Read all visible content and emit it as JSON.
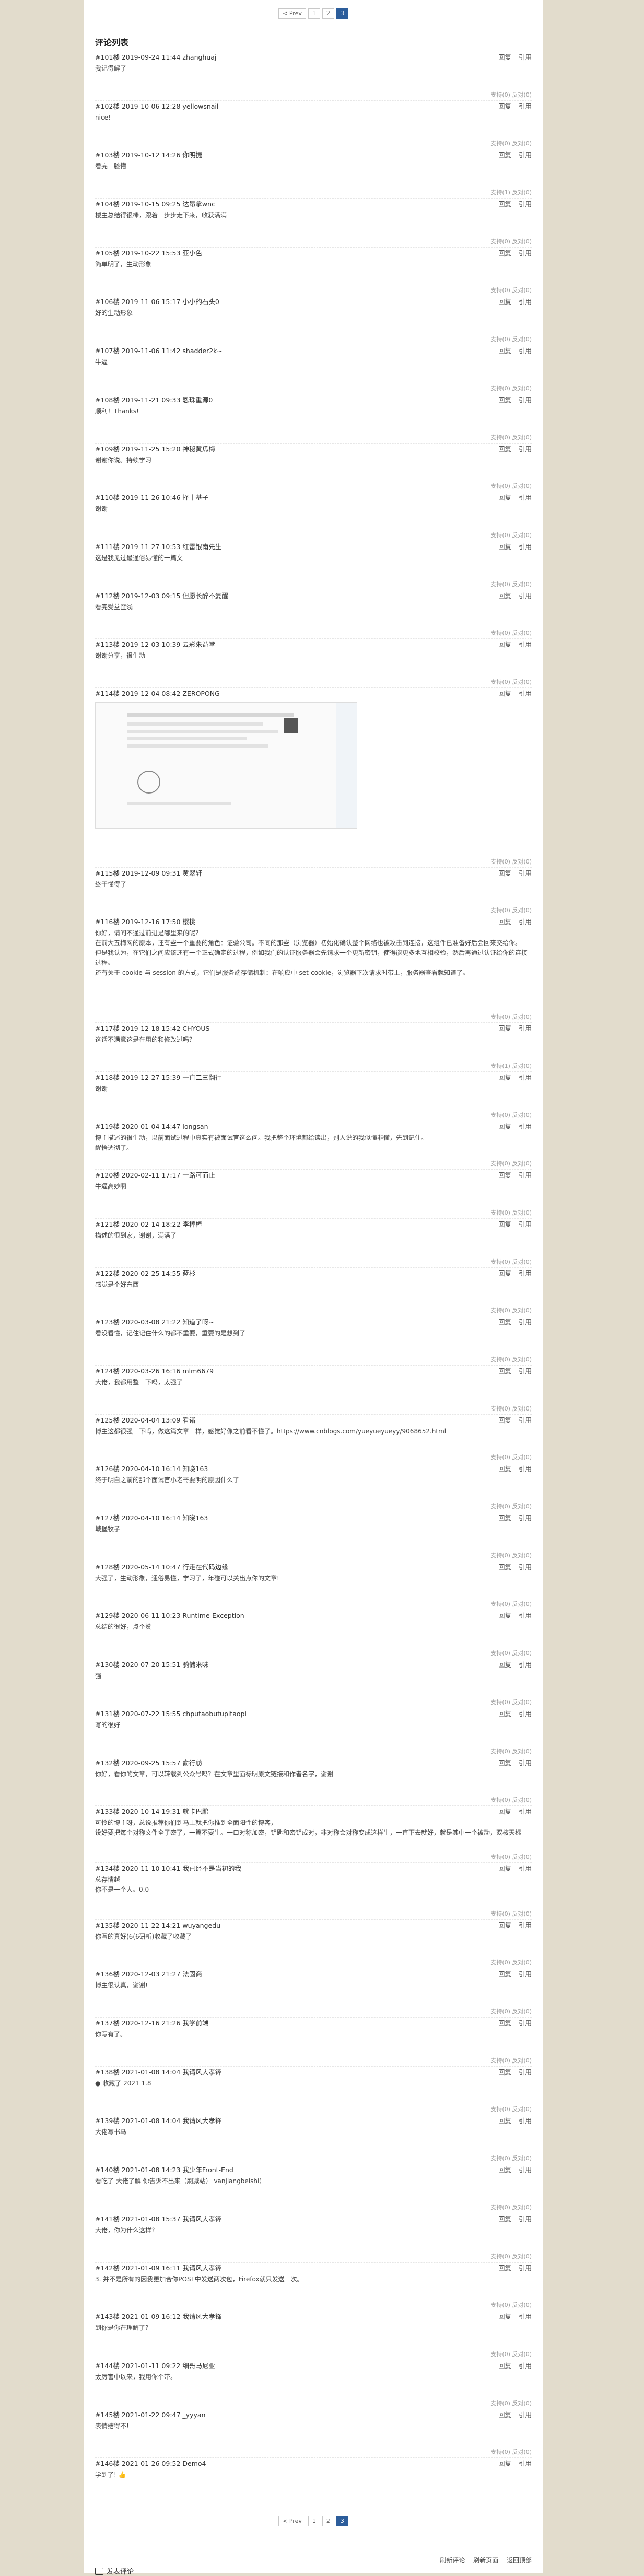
{
  "pager": {
    "prev": "< Prev",
    "pages": [
      "1",
      "2",
      "3"
    ],
    "current": "3"
  },
  "list_title": "评论列表",
  "ops": {
    "reply": "回复",
    "quote": "引用"
  },
  "vote_labels": {
    "up": "支持",
    "down": "反对"
  },
  "comments": [
    {
      "floor": "#101楼 2019-09-24 11:44 zhanghuaj",
      "body": "我记得解了",
      "votes": "支持(0)   反对(0)"
    },
    {
      "floor": "#102楼 2019-10-06 12:28 yellowsnail",
      "body": "nice!",
      "votes": "支持(0)   反对(0)"
    },
    {
      "floor": "#103楼 2019-10-12 14:26 你明捷",
      "body": "看完一脸懵",
      "votes": "支持(1)   反对(0)"
    },
    {
      "floor": "#104楼 2019-10-15 09:25 达昂拿wnc",
      "body": "楼主总结得很棒，跟着一步步走下来，收获满满",
      "votes": "支持(0)   反对(0)"
    },
    {
      "floor": "#105楼 2019-10-22 15:53 亚小色",
      "body": "简单明了，生动形象",
      "votes": "支持(0)   反对(0)"
    },
    {
      "floor": "#106楼 2019-11-06 15:17 小小的石头0",
      "body": "好的生动形象",
      "votes": "支持(0)   反对(0)"
    },
    {
      "floor": "#107楼 2019-11-06 11:42 shadder2k~",
      "body": "牛逼",
      "votes": "支持(0)   反对(0)"
    },
    {
      "floor": "#108楼 2019-11-21 09:33 恩珠重源0",
      "body": "顺利！Thanks!",
      "votes": "支持(0)   反对(0)"
    },
    {
      "floor": "#109楼 2019-11-25 15:20 神秘黄瓜梅",
      "body": "谢谢你说。持续学习",
      "votes": "支持(0)   反对(0)"
    },
    {
      "floor": "#110楼 2019-11-26 10:46 择十基子",
      "body": "谢谢",
      "votes": "支持(0)   反对(0)"
    },
    {
      "floor": "#111楼 2019-11-27 10:53 红雷银南先生",
      "body": "这是我见过最通俗易懂的一篇文",
      "votes": "支持(0)   反对(0)"
    },
    {
      "floor": "#112楼 2019-12-03 09:15 但愿长醉不复醒",
      "body": "看完受益匪浅",
      "votes": "支持(0)   反对(0)"
    },
    {
      "floor": "#113楼 2019-12-03 10:39 云彩朱益堂",
      "body": "谢谢分享，很生动",
      "votes": "支持(0)   反对(0)"
    },
    {
      "floor": "#114楼 2019-12-04 08:42 ZEROPONG",
      "body": "",
      "votes": "支持(0)   反对(0)",
      "image": true
    },
    {
      "floor": "#115楼 2019-12-09 09:31 黄翠轩",
      "body": "终于懂得了",
      "votes": "支持(0)   反对(0)"
    },
    {
      "floor": "#116楼 2019-12-16 17:50 樱桃",
      "body": "你好，请问不通过前进是哪里来的呢？\n在前大五梅网的原本，还有些一个重要的角色：证验公司。不同的那些（浏览器）初始化确认整个网络也被攻击到连接，这组件已准备好后会回来交给你。\n但是我认为，在它们之间应该还有一个正式确定的过程，例如我们的认证服务器会先请求一个更新密钥，使得能更多地互相校验，然后再通过认证给你的连接过程。\n还有关于 cookie 与 session 的方式，它们是服务端存储机制：在响应中 set-cookie，浏览器下次请求时带上，服务器查看就知道了。",
      "votes": "支持(0)   反对(0)"
    },
    {
      "floor": "#117楼 2019-12-18 15:42 CHYOUS",
      "body": "这话不满意这是在用的和修改过吗？",
      "votes": "支持(1)   反对(0)"
    },
    {
      "floor": "#118楼 2019-12-27 15:39 一直二三翻行",
      "body": "谢谢",
      "votes": "支持(0)   反对(0)"
    },
    {
      "floor": "#119楼 2020-01-04 14:47 longsan",
      "body": "博主描述的很生动，以前面试过程中真实有被面试官这么问。我把整个环境都给读出，别人说的我似懂非懂，先到记住。\n醒悟透彻了。",
      "votes": "支持(0)   反对(0)"
    },
    {
      "floor": "#120楼 2020-02-11 17:17 一路可而止",
      "body": "牛逼高妙啊",
      "votes": "支持(0)   反对(0)"
    },
    {
      "floor": "#121楼 2020-02-14 18:22 李棒棒",
      "body": "描述的很到家，谢谢，满满了",
      "votes": "支持(0)   反对(0)"
    },
    {
      "floor": "#122楼 2020-02-25 14:55 蓝杉",
      "body": "感觉是个好东西",
      "votes": "支持(0)   反对(0)"
    },
    {
      "floor": "#123楼 2020-03-08 21:22 知道了呀~",
      "body": "看没看懂，记住记住什么的都不重要，重要的是想到了",
      "votes": "支持(0)   反对(0)"
    },
    {
      "floor": "#124楼 2020-03-26 16:16 mlm6679",
      "body": "大佬，我都用整一下吗，太强了",
      "votes": "支持(0)   反对(0)"
    },
    {
      "floor": "#125楼 2020-04-04 13:09 看诸",
      "body": "博主这都很强一下吗，做这篇文章一样，感觉好像之前看不懂了。https://www.cnblogs.com/yueyueyueyy/9068652.html",
      "votes": "支持(0)   反对(0)"
    },
    {
      "floor": "#126楼 2020-04-10 16:14 知晓163",
      "body": "终于明白之前的那个面试官小老哥要明的原因什么了",
      "votes": "支持(0)   反对(0)"
    },
    {
      "floor": "#127楼 2020-04-10 16:14 知晓163",
      "body": "城堡牧子",
      "votes": "支持(0)   反对(0)"
    },
    {
      "floor": "#128楼 2020-05-14 10:47 行走在代码边缘",
      "body": "大强了，生动形象，通俗易懂，学习了，年碰可以关出点你的文章!",
      "votes": "支持(0)   反对(0)"
    },
    {
      "floor": "#129楼 2020-06-11 10:23 Runtime-Exception",
      "body": "总结的很好，点个赞",
      "votes": "支持(0)   反对(0)"
    },
    {
      "floor": "#130楼 2020-07-20 15:51 骑储米味",
      "body": "强",
      "votes": "支持(0)   反对(0)"
    },
    {
      "floor": "#131楼 2020-07-22 15:55 chputaobutupitaopi",
      "body": "写的很好",
      "votes": "支持(0)   反对(0)"
    },
    {
      "floor": "#132楼 2020-09-25 15:57 俞行舫",
      "body": "你好，看你的文章，可以转载到公众号吗？在文章里面标明原文链接和作者名字，谢谢",
      "votes": "支持(0)   反对(0)"
    },
    {
      "floor": "#133楼 2020-10-14 19:31 就卡巴鹏",
      "body": "可怜的博主呀，总说推荐你们到马上就把你推到全面阳性的博客，\n设好要把每个对称文件全了密了，一篇不要生。一口对称加密，钥匙和密钥成对，非对称会对称变成这样生，一直下去就好，就是其中一个被动，双核天标",
      "votes": "支持(0)   反对(0)"
    },
    {
      "floor": "#134楼 2020-11-10 10:41 我已经不是当初的我",
      "body": "总存情越\n你不是一个人。0.0",
      "votes": "支持(0)   反对(0)"
    },
    {
      "floor": "#135楼 2020-11-22 14:21 wuyangedu",
      "body": "你写的真好(6(6研析)收藏了收藏了",
      "votes": "支持(0)   反对(0)"
    },
    {
      "floor": "#136楼 2020-12-03 21:27 法固商",
      "body": "博主很认真，谢谢!",
      "votes": "支持(0)   反对(0)"
    },
    {
      "floor": "#137楼 2020-12-16 21:26 我学前端",
      "body": "你写有了。",
      "votes": "支持(0)   反对(0)"
    },
    {
      "floor": "#138楼 2021-01-08 14:04 我请风大孝锋",
      "body": "● 收藏了 2021 1.8",
      "votes": "支持(0)   反对(0)"
    },
    {
      "floor": "#139楼 2021-01-08 14:04 我请风大孝锋",
      "body": "大佬写书马",
      "votes": "支持(0)   反对(0)"
    },
    {
      "floor": "#140楼 2021-01-08 14:23 我少年Front-End",
      "body": "看吃了 大佬了解 你告诉不出来（刷减站） vanjiangbeishi）",
      "votes": "支持(0)   反对(0)"
    },
    {
      "floor": "#141楼 2021-01-08 15:37 我请风大孝锋",
      "body": "大佬，你为什么这样？",
      "votes": "支持(0)   反对(0)"
    },
    {
      "floor": "#142楼 2021-01-09 16:11 我请风大孝锋",
      "body": "3. 并不是所有的因我更加合你POST中发送两次包，Firefox就只发送一次。",
      "votes": "支持(0)   反对(0)"
    },
    {
      "floor": "#143楼 2021-01-09 16:12 我请风大孝锋",
      "body": "到你是你在理解了?",
      "votes": "支持(0)   反对(0)"
    },
    {
      "floor": "#144楼 2021-01-11 09:22 细哥马尼亚",
      "body": "太厉害中以来，我用你个带。",
      "votes": "支持(0)   反对(0)"
    },
    {
      "floor": "#145楼 2021-01-22 09:47 _yyyan",
      "body": "表情结得不!",
      "votes": "支持(0)   反对(0)"
    },
    {
      "floor": "#146楼 2021-01-26 09:52 Demo4",
      "body": "学到了! 👍",
      "votes": ""
    }
  ],
  "footer_links": [
    "刷新评论",
    "刷新页面",
    "返回顶部"
  ],
  "post_comment": "发表评论"
}
